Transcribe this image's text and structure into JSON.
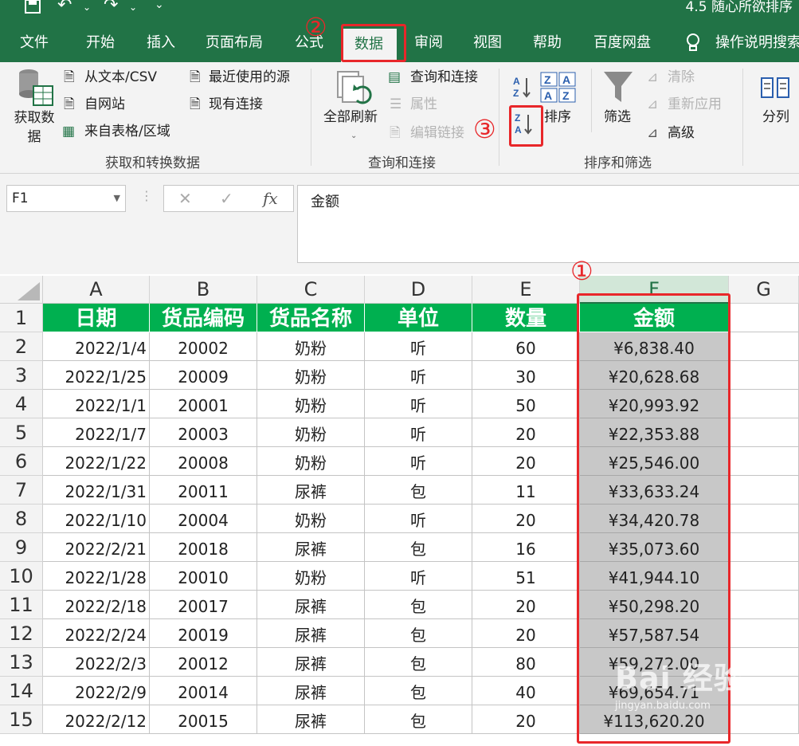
{
  "window": {
    "title": "4.5 随心所欲排序"
  },
  "quick_access": {
    "save": "save-icon",
    "undo": "undo-icon",
    "redo": "redo-icon",
    "customize": "customize-icon"
  },
  "tabs": [
    {
      "label": "文件"
    },
    {
      "label": "开始"
    },
    {
      "label": "插入"
    },
    {
      "label": "页面布局"
    },
    {
      "label": "公式"
    },
    {
      "label": "数据"
    },
    {
      "label": "审阅"
    },
    {
      "label": "视图"
    },
    {
      "label": "帮助"
    },
    {
      "label": "百度网盘"
    }
  ],
  "tell_me": {
    "label": "操作说明搜索"
  },
  "ribbon": {
    "get_data": "获取数据",
    "from_text_csv": "从文本/CSV",
    "from_web": "自网站",
    "from_table": "来自表格/区域",
    "recent_sources": "最近使用的源",
    "existing_connections": "现有连接",
    "group_get_transform": "获取和转换数据",
    "refresh_all": "全部刷新",
    "queries_connections": "查询和连接",
    "properties": "属性",
    "edit_links": "编辑链接",
    "group_queries": "查询和连接",
    "sort": "排序",
    "filter": "筛选",
    "clear": "清除",
    "reapply": "重新应用",
    "advanced": "高级",
    "group_sort_filter": "排序和筛选",
    "text_to_columns": "分列"
  },
  "formula_bar": {
    "name_box": "F1",
    "content": "金额"
  },
  "annotations": {
    "one": "①",
    "two": "②",
    "three": "③"
  },
  "columns": [
    "A",
    "B",
    "C",
    "D",
    "E",
    "F",
    "G"
  ],
  "headers": [
    "日期",
    "货品编码",
    "货品名称",
    "单位",
    "数量",
    "金额"
  ],
  "rows": [
    {
      "n": "2",
      "date": "2022/1/4",
      "code": "20002",
      "name": "奶粉",
      "unit": "听",
      "qty": "60",
      "amount": "¥6,838.40"
    },
    {
      "n": "3",
      "date": "2022/1/25",
      "code": "20009",
      "name": "奶粉",
      "unit": "听",
      "qty": "30",
      "amount": "¥20,628.68"
    },
    {
      "n": "4",
      "date": "2022/1/1",
      "code": "20001",
      "name": "奶粉",
      "unit": "听",
      "qty": "50",
      "amount": "¥20,993.92"
    },
    {
      "n": "5",
      "date": "2022/1/7",
      "code": "20003",
      "name": "奶粉",
      "unit": "听",
      "qty": "20",
      "amount": "¥22,353.88"
    },
    {
      "n": "6",
      "date": "2022/1/22",
      "code": "20008",
      "name": "奶粉",
      "unit": "听",
      "qty": "20",
      "amount": "¥25,546.00"
    },
    {
      "n": "7",
      "date": "2022/1/31",
      "code": "20011",
      "name": "尿裤",
      "unit": "包",
      "qty": "11",
      "amount": "¥33,633.24"
    },
    {
      "n": "8",
      "date": "2022/1/10",
      "code": "20004",
      "name": "奶粉",
      "unit": "听",
      "qty": "20",
      "amount": "¥34,420.78"
    },
    {
      "n": "9",
      "date": "2022/2/21",
      "code": "20018",
      "name": "尿裤",
      "unit": "包",
      "qty": "16",
      "amount": "¥35,073.60"
    },
    {
      "n": "10",
      "date": "2022/1/28",
      "code": "20010",
      "name": "奶粉",
      "unit": "听",
      "qty": "51",
      "amount": "¥41,944.10"
    },
    {
      "n": "11",
      "date": "2022/2/18",
      "code": "20017",
      "name": "尿裤",
      "unit": "包",
      "qty": "20",
      "amount": "¥50,298.20"
    },
    {
      "n": "12",
      "date": "2022/2/24",
      "code": "20019",
      "name": "尿裤",
      "unit": "包",
      "qty": "20",
      "amount": "¥57,587.54"
    },
    {
      "n": "13",
      "date": "2022/2/3",
      "code": "20012",
      "name": "尿裤",
      "unit": "包",
      "qty": "80",
      "amount": "¥59,272.00"
    },
    {
      "n": "14",
      "date": "2022/2/9",
      "code": "20014",
      "name": "尿裤",
      "unit": "包",
      "qty": "40",
      "amount": "¥69,654.71"
    },
    {
      "n": "15",
      "date": "2022/2/12",
      "code": "20015",
      "name": "尿裤",
      "unit": "包",
      "qty": "20",
      "amount": "¥113,620.20"
    }
  ],
  "watermark": {
    "brand": "Bai 经验",
    "site": "jingyan.baidu.com"
  },
  "colors": {
    "excel_green": "#217346",
    "header_fill": "#00b050",
    "highlight_red": "#e8272a",
    "selected_fill": "#c8c8c8"
  }
}
